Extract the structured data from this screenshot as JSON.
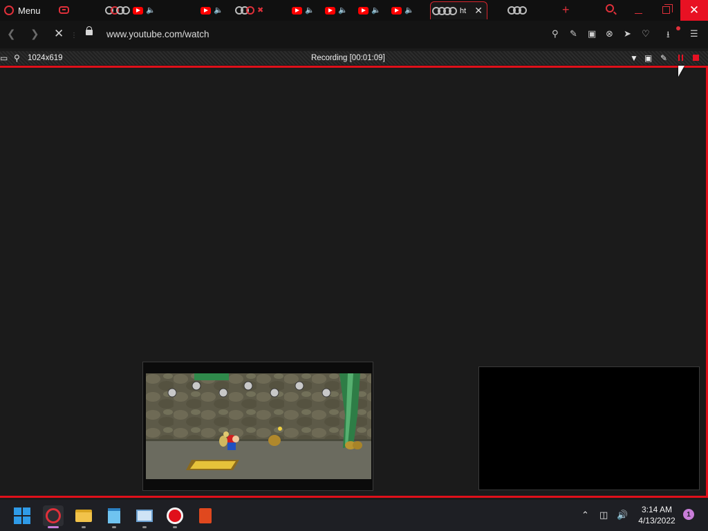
{
  "browser": {
    "menu_label": "Menu",
    "active_tab_title": "ht",
    "url": "www.youtube.com/watch",
    "tabs": [
      {
        "kind": "loading"
      },
      {
        "kind": "youtube",
        "audio": "playing"
      },
      {
        "kind": "youtube",
        "audio": "playing"
      },
      {
        "kind": "loading"
      },
      {
        "kind": "youtube",
        "audio": "muted"
      },
      {
        "kind": "youtube",
        "audio": "playing"
      },
      {
        "kind": "youtube",
        "audio": "muted"
      },
      {
        "kind": "youtube",
        "audio": "playing"
      },
      {
        "kind": "youtube",
        "audio": "muted"
      },
      {
        "kind": "loading",
        "active": true
      },
      {
        "kind": "loading"
      }
    ]
  },
  "recorder": {
    "size_label": "1024x619",
    "status_label": "Recording [00:01:09]"
  },
  "taskbar": {
    "apps": [
      "start",
      "opera",
      "file-explorer",
      "notepad",
      "photos",
      "recorder",
      "office"
    ],
    "active_app": "opera",
    "clock_time": "3:14 AM",
    "clock_date": "4/13/2022",
    "notification_count": "1"
  },
  "colors": {
    "accent": "#e0303a",
    "recording_border": "#e0101a",
    "close_button": "#e81123",
    "taskbar_accent": "#c87dd8"
  }
}
